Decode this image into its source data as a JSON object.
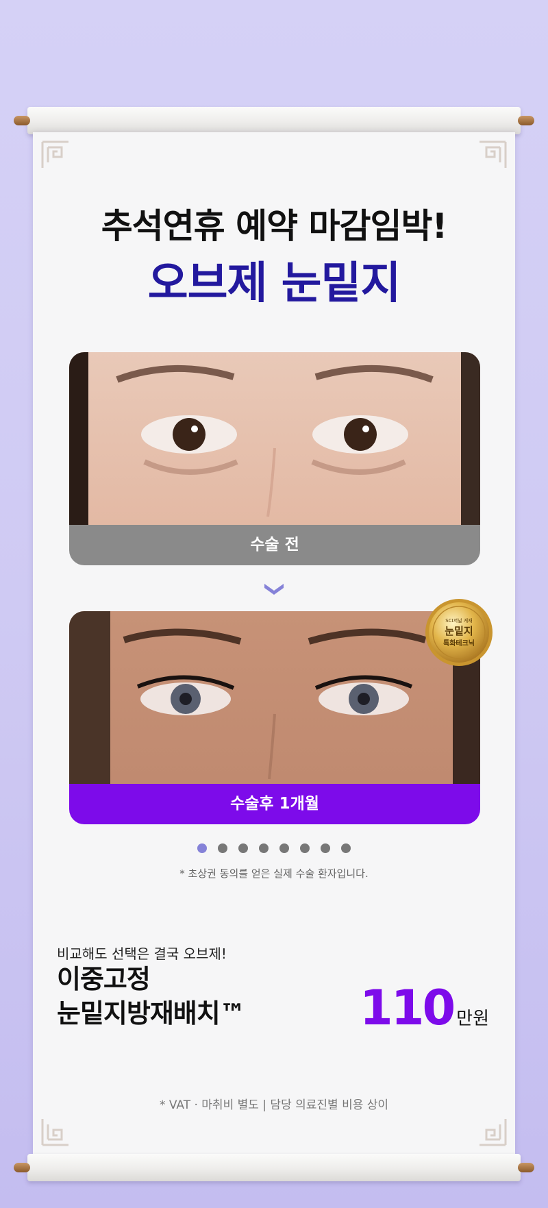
{
  "headline": {
    "line1": "추석연휴 예약 마감임박!",
    "line2": "오브제 눈밑지"
  },
  "before_card": {
    "caption": "수술 전"
  },
  "after_card": {
    "caption": "수술후 1개월"
  },
  "badge": {
    "small_text": "SCI저널 게재",
    "main_text": "눈밑지",
    "sub_text": "특화테크닉"
  },
  "carousel": {
    "total_dots": 8,
    "active_index": 0
  },
  "consent_notice": "* 초상권 동의를 얻은 실제 수술 환자입니다.",
  "promo": {
    "subtitle": "비교해도 선택은 결국 오브제!",
    "name_line1": "이중고정",
    "name_line2": "눈밑지방재배치™",
    "price": "110",
    "price_unit": "만원"
  },
  "footnote": "* VAT · 마취비 별도 | 담당 의료진별 비용 상이",
  "colors": {
    "accent_purple": "#7d0bea",
    "headline_navy": "#23199e",
    "background_lavender": "#d5d1f6"
  }
}
